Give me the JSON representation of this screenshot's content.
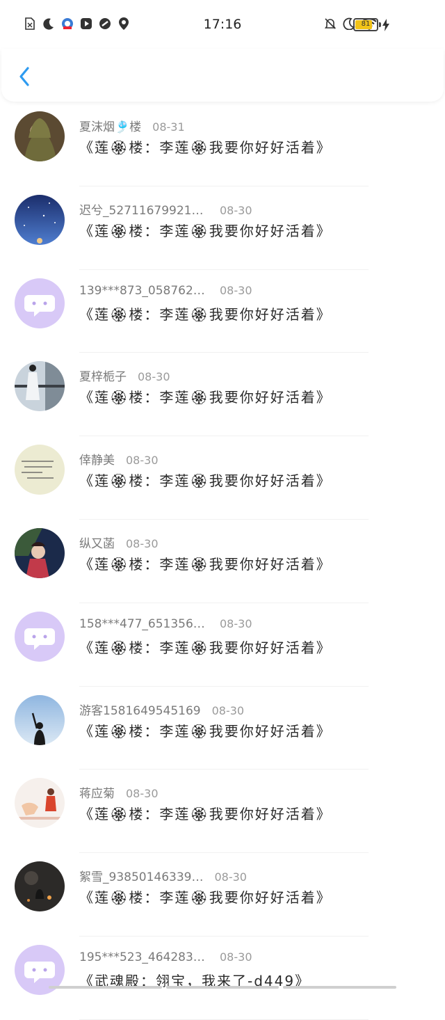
{
  "status_bar": {
    "time": "17:16",
    "battery": "81",
    "left_icons": [
      "sim-off-icon",
      "moon-icon",
      "app-icon",
      "play-icon",
      "link-icon",
      "location-icon"
    ],
    "right_icons": [
      "bell-off-icon",
      "moon-icon",
      "wifi-icon"
    ]
  },
  "header": {
    "back_icon": "chevron-left-icon"
  },
  "comments": [
    {
      "name": "夏沫烟🎐楼",
      "date": "08-31",
      "text": "《莲🏵楼：李莲🏵我要你好好活着》",
      "avatar": "photo-girl-hood"
    },
    {
      "name": "迟兮_5271167992171…",
      "date": "08-30",
      "text": "《莲🏵楼：李莲🏵我要你好好活着》",
      "avatar": "photo-starry-sky"
    },
    {
      "name": "139***873_0587629…",
      "date": "08-30",
      "text": "《莲🏵楼：李莲🏵我要你好好活着》",
      "avatar": "default-chat"
    },
    {
      "name": "夏梓栀子",
      "date": "08-30",
      "text": "《莲🏵楼：李莲🏵我要你好好活着》",
      "avatar": "photo-girl-window"
    },
    {
      "name": "倖静美",
      "date": "08-30",
      "text": "《莲🏵楼：李莲🏵我要你好好活着》",
      "avatar": "photo-handwriting"
    },
    {
      "name": "纵又菡",
      "date": "08-30",
      "text": "《莲🏵楼：李莲🏵我要你好好活着》",
      "avatar": "photo-anime"
    },
    {
      "name": "158***477_6513565325",
      "date": "08-30",
      "text": "《莲🏵楼：李莲🏵我要你好好活着》",
      "avatar": "default-chat"
    },
    {
      "name": "游客1581649545169",
      "date": "08-30",
      "text": "《莲🏵楼：李莲🏵我要你好好活着》",
      "avatar": "photo-silhouette"
    },
    {
      "name": "蒋应菊",
      "date": "08-30",
      "text": "《莲🏵楼：李莲🏵我要你好好活着》",
      "avatar": "photo-illustration"
    },
    {
      "name": "絮雪_93850146339…",
      "date": "08-30",
      "text": "《莲🏵楼：李莲🏵我要你好好活着》",
      "avatar": "photo-dark"
    },
    {
      "name": "195***523_4642837…",
      "date": "08-30",
      "text": "《武魂殿：翎宝，我来了-d449》",
      "avatar": "default-chat"
    }
  ]
}
